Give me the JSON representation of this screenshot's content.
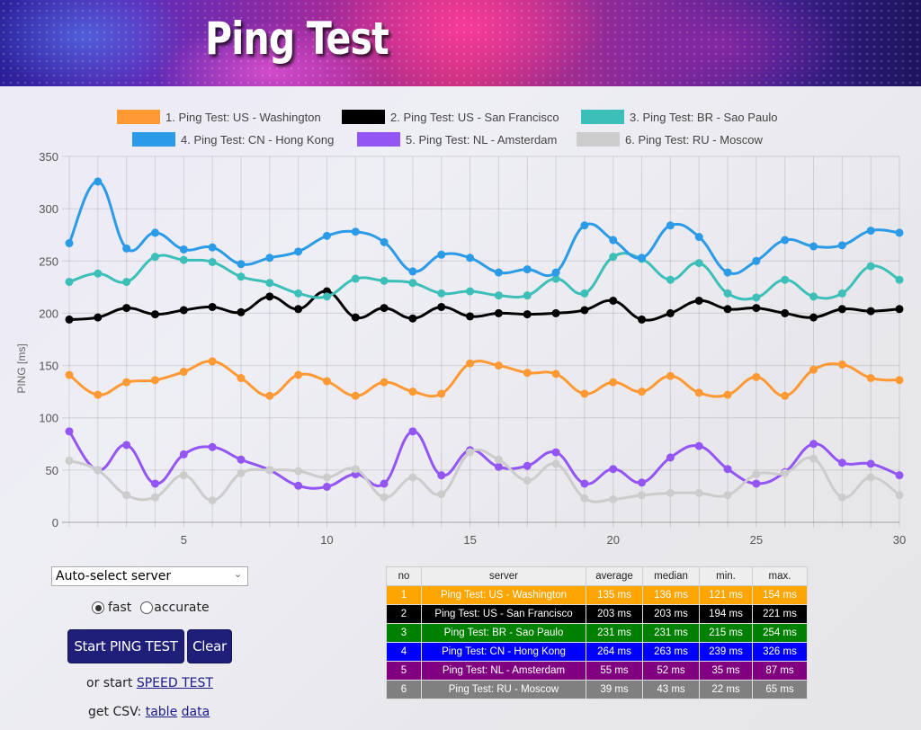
{
  "header": {
    "title": "Ping Test"
  },
  "controls": {
    "server_select": "Auto-select server",
    "mode_options": [
      {
        "label": "fast",
        "selected": true
      },
      {
        "label": "accurate",
        "selected": false
      }
    ],
    "start_button": "Start PING TEST",
    "clear_button": "Clear",
    "speed_prefix": "or start",
    "speed_link": "SPEED TEST",
    "csv_prefix": "get CSV:",
    "csv_table_link": "table",
    "csv_data_link": "data"
  },
  "results_table": {
    "headers": [
      "no",
      "server",
      "average",
      "median",
      "min.",
      "max."
    ],
    "rows": [
      {
        "cells": [
          "1",
          "Ping Test: US - Washington",
          "135 ms",
          "136 ms",
          "121 ms",
          "154 ms"
        ],
        "color": "#ffa500"
      },
      {
        "cells": [
          "2",
          "Ping Test: US - San Francisco",
          "203 ms",
          "203 ms",
          "194 ms",
          "221 ms"
        ],
        "color": "#000000"
      },
      {
        "cells": [
          "3",
          "Ping Test: BR - Sao Paulo",
          "231 ms",
          "231 ms",
          "215 ms",
          "254 ms"
        ],
        "color": "#008000"
      },
      {
        "cells": [
          "4",
          "Ping Test: CN - Hong Kong",
          "264 ms",
          "263 ms",
          "239 ms",
          "326 ms"
        ],
        "color": "#0000ff"
      },
      {
        "cells": [
          "5",
          "Ping Test: NL - Amsterdam",
          "55 ms",
          "52 ms",
          "35 ms",
          "87 ms"
        ],
        "color": "#800080"
      },
      {
        "cells": [
          "6",
          "Ping Test: RU - Moscow",
          "39 ms",
          "43 ms",
          "22 ms",
          "65 ms"
        ],
        "color": "#808080"
      }
    ]
  },
  "chart_data": {
    "type": "line",
    "title": "",
    "xlabel": "",
    "ylabel": "PING [ms]",
    "ylim": [
      0,
      350
    ],
    "xlim": [
      1,
      30
    ],
    "yticks": [
      0,
      50,
      100,
      150,
      200,
      250,
      300,
      350
    ],
    "xticks": [
      5,
      10,
      15,
      20,
      25,
      30
    ],
    "grid": true,
    "legend_position": "top",
    "x": [
      1,
      2,
      3,
      4,
      5,
      6,
      7,
      8,
      9,
      10,
      11,
      12,
      13,
      14,
      15,
      16,
      17,
      18,
      19,
      20,
      21,
      22,
      23,
      24,
      25,
      26,
      27,
      28,
      29,
      30
    ],
    "series": [
      {
        "name": "1. Ping Test: US - Washington",
        "color": "#ff9933",
        "values": [
          141,
          122,
          134,
          136,
          144,
          154,
          138,
          121,
          141,
          135,
          121,
          134,
          125,
          123,
          152,
          150,
          143,
          142,
          123,
          134,
          125,
          140,
          124,
          122,
          139,
          121,
          146,
          151,
          138,
          136
        ]
      },
      {
        "name": "2. Ping Test: US - San Francisco",
        "color": "#000000",
        "values": [
          194,
          196,
          205,
          199,
          203,
          206,
          201,
          216,
          204,
          221,
          196,
          205,
          195,
          206,
          197,
          200,
          199,
          200,
          203,
          212,
          194,
          200,
          212,
          204,
          205,
          200,
          196,
          204,
          202,
          204
        ]
      },
      {
        "name": "3. Ping Test: BR - Sao Paulo",
        "color": "#3cbfb8",
        "values": [
          230,
          238,
          230,
          254,
          251,
          249,
          235,
          229,
          219,
          216,
          233,
          231,
          229,
          219,
          221,
          217,
          217,
          233,
          219,
          254,
          252,
          232,
          248,
          219,
          215,
          232,
          216,
          219,
          245,
          232
        ]
      },
      {
        "name": "4. Ping Test: CN - Hong Kong",
        "color": "#2b9be8",
        "values": [
          267,
          326,
          262,
          277,
          261,
          263,
          247,
          253,
          259,
          274,
          278,
          268,
          240,
          256,
          253,
          239,
          242,
          239,
          284,
          270,
          253,
          284,
          273,
          239,
          250,
          270,
          264,
          265,
          279,
          277
        ]
      },
      {
        "name": "5. Ping Test: NL - Amsterdam",
        "color": "#9455f5",
        "values": [
          87,
          50,
          74,
          37,
          65,
          72,
          60,
          50,
          35,
          34,
          46,
          37,
          87,
          45,
          69,
          53,
          54,
          67,
          37,
          51,
          38,
          62,
          73,
          51,
          37,
          48,
          75,
          57,
          56,
          45
        ]
      },
      {
        "name": "6. Ping Test: RU - Moscow",
        "color": "#cccccc",
        "values": [
          59,
          50,
          26,
          24,
          45,
          21,
          47,
          50,
          49,
          43,
          51,
          24,
          43,
          27,
          67,
          60,
          40,
          56,
          23,
          22,
          26,
          28,
          28,
          26,
          46,
          47,
          61,
          24,
          43,
          26
        ]
      }
    ]
  }
}
